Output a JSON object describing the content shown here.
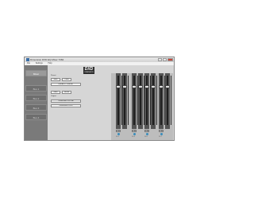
{
  "window": {
    "title": "Dimension DXD EQ Mixer 7384"
  },
  "menu": [
    "File",
    "Settings",
    "Help"
  ],
  "sidebar": {
    "items": [
      {
        "label": "Mixer",
        "active": true
      },
      {
        "label": "Bus 1",
        "active": false
      },
      {
        "label": "Bus 2",
        "active": false
      },
      {
        "label": "Bus 3",
        "active": false
      },
      {
        "label": "Bus 4",
        "active": false
      }
    ]
  },
  "logo": {
    "text": "DXD",
    "sub": "DIMENSION"
  },
  "presets": {
    "label": "Preset",
    "buttons": [
      "Save",
      "Load"
    ],
    "current": "DEFAULT PRESET",
    "buttons2": [
      "Store",
      "Recall"
    ]
  },
  "routing": {
    "label": "Output",
    "selected": "Dimension DXD-8A",
    "mode": "Dimension DXD8"
  },
  "channels": [
    {
      "value": "0 dB",
      "level": 0.2
    },
    {
      "value": "0 dB",
      "level": 0.2
    },
    {
      "value": "0 dB",
      "level": 0.2
    },
    {
      "value": "0 dB",
      "level": 0.2
    },
    {
      "value": "0 dB",
      "level": 0.2
    },
    {
      "value": "0 dB",
      "level": 0.2
    },
    {
      "value": "0 dB",
      "level": 0.2
    },
    {
      "value": "0 dB",
      "level": 0.2
    }
  ],
  "channel_labels": [
    "Ch 1",
    "Ch 2",
    "Ch 3",
    "Ch 4",
    "Ch 5",
    "Ch 6",
    "Ch 7",
    "Ch 8"
  ],
  "colors": {
    "accent": "#3b8dbb",
    "sidebar": "#7a7a7a",
    "titlebar": "#dcdcdc"
  }
}
